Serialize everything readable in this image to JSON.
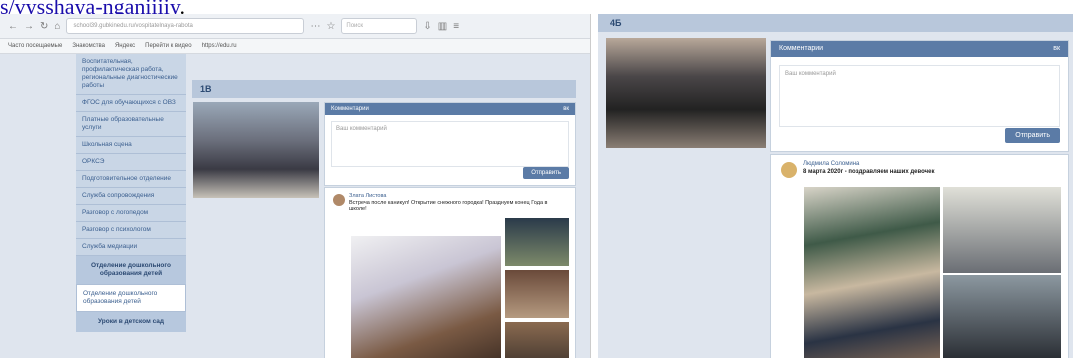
{
  "caption": {
    "link_text": "s/vysshaya-nganiiiiy",
    "tail_text": "."
  },
  "left_browser": {
    "url": "school39.gubkinedu.ru/vospitatelnaya-rabota",
    "search_placeholder": "Поиск",
    "bookmarks": [
      "Часто посещаемые",
      "Знакомства",
      "Яндекс",
      "Перейти к видео",
      "https://edu.ru"
    ],
    "sidebar": {
      "items": [
        "Воспитательная, профилактическая работа, региональные диагностические работы",
        "ФГОС для обучающихся с ОВЗ",
        "Платные образовательные услуги",
        "Школьная сцена",
        "ОРКСЭ",
        "Подготовительное отделение",
        "Служба сопровождения",
        "Разговор с логопедом",
        "Разговор с психологом",
        "Служба медиации"
      ],
      "section_head": "Отделение дошкольного образования детей",
      "section_sub": "Отделение дошкольного образования детей",
      "section_head_2": "Уроки в детском сад"
    },
    "group_title": "1В",
    "comment_header": "Комментарии",
    "comment_placeholder": "Ваш комментарий",
    "send_label": "Отправить",
    "post_author": "Злата Листова",
    "post_text": "Встреча после каникул! Открытие снежного городка! Празднуем конец Года в школе!"
  },
  "right_browser": {
    "group_title": "4Б",
    "comment_header": "Комментарии",
    "comment_placeholder": "Ваш комментарий",
    "send_label": "Отправить",
    "post_author": "Людмила Соломина",
    "post_text": "8 марта 2020г - поздравляем наших девочек"
  },
  "colors": {
    "accent": "#5b7ba6",
    "sidebar_bg": "#c9d6e6",
    "page_bg": "#dfe5ee"
  }
}
